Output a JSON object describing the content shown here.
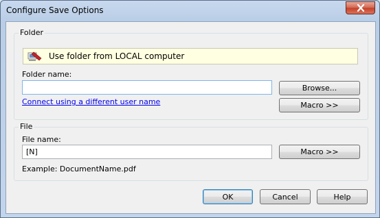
{
  "window": {
    "title": "Configure Save Options"
  },
  "folder_group": {
    "label": "Folder",
    "banner_text": "Use folder from LOCAL computer",
    "folder_name_label": "Folder name:",
    "folder_name_value": "",
    "browse_label": "Browse...",
    "connect_link": "Connect using a different user name",
    "macro_label": "Macro >>"
  },
  "file_group": {
    "label": "File",
    "file_name_label": "File name:",
    "file_name_value": "[N]",
    "macro_label": "Macro >>",
    "example_text": "Example: DocumentName.pdf"
  },
  "footer": {
    "ok_label": "OK",
    "cancel_label": "Cancel",
    "help_label": "Help"
  },
  "icons": {
    "close": "close-icon",
    "banner": "local-computer-icon"
  },
  "colors": {
    "banner_bg": "#ffffe1",
    "link": "#0000ee",
    "close_button": "#c43f27"
  }
}
